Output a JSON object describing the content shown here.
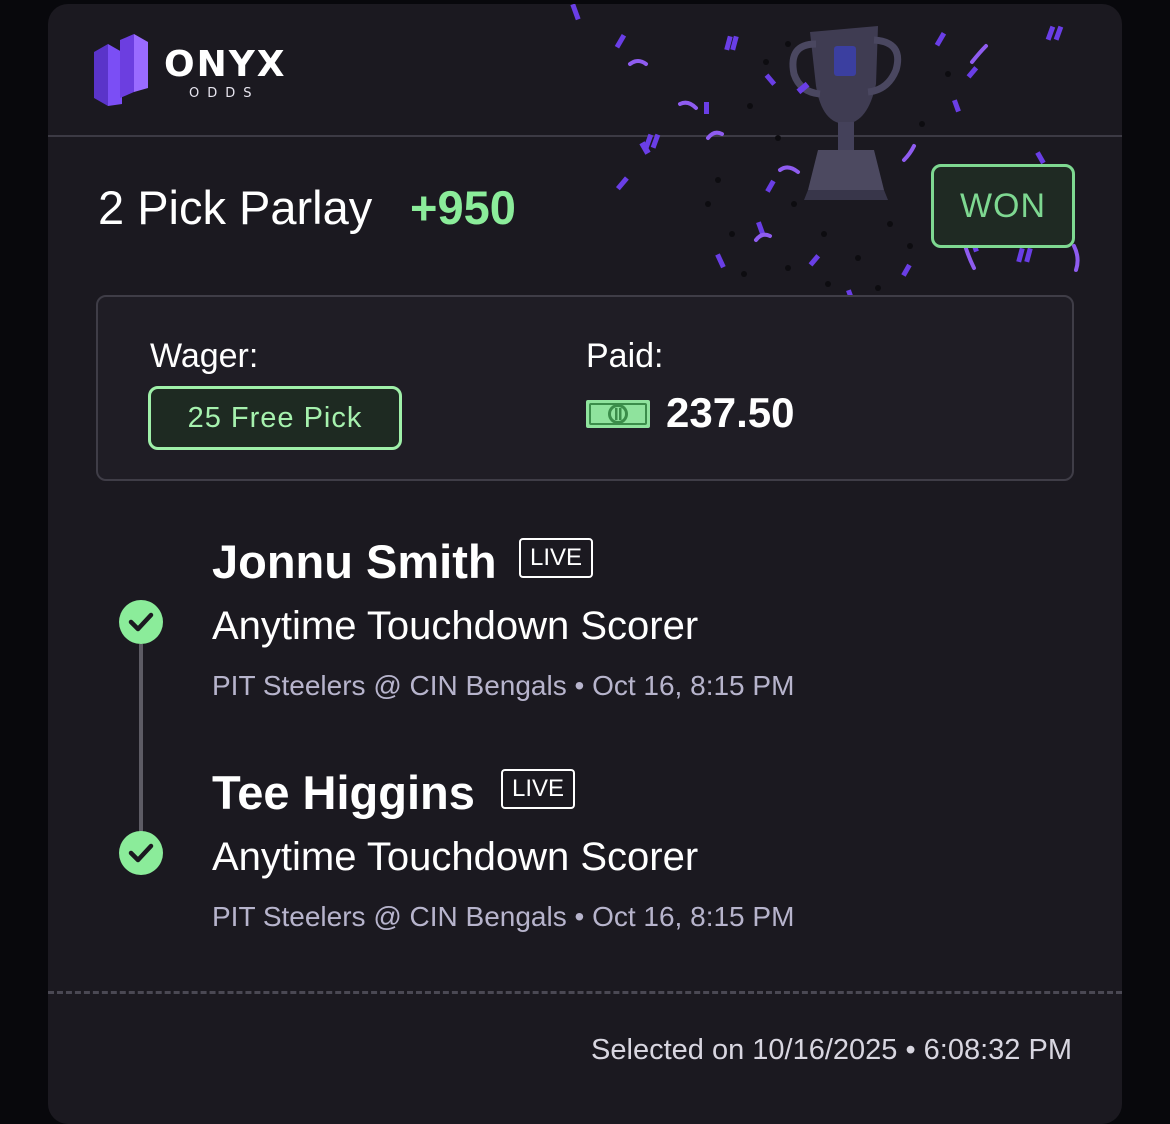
{
  "brand": {
    "name": "ONYX",
    "sub": "ODDS"
  },
  "bet": {
    "title": "2 Pick Parlay",
    "odds": "+950",
    "status": "WON",
    "wager_label": "Wager:",
    "wager_value": "25 Free Pick",
    "paid_label": "Paid:",
    "paid_value": "237.50"
  },
  "picks": [
    {
      "player": "Jonnu Smith",
      "live": "LIVE",
      "market": "Anytime Touchdown Scorer",
      "game": "PIT Steelers @ CIN Bengals • Oct 16, 8:15 PM"
    },
    {
      "player": "Tee Higgins",
      "live": "LIVE",
      "market": "Anytime Touchdown Scorer",
      "game": "PIT Steelers @ CIN Bengals • Oct 16, 8:15 PM"
    }
  ],
  "footer": {
    "selected": "Selected on 10/16/2025 • 6:08:32 PM"
  },
  "colors": {
    "accent_green": "#8bec9a",
    "brand_purple": "#7a4cf0",
    "card_bg": "#1b1920"
  },
  "icons": [
    "onyx-logo-icon",
    "trophy-icon",
    "cash-icon",
    "check-circle-icon"
  ]
}
